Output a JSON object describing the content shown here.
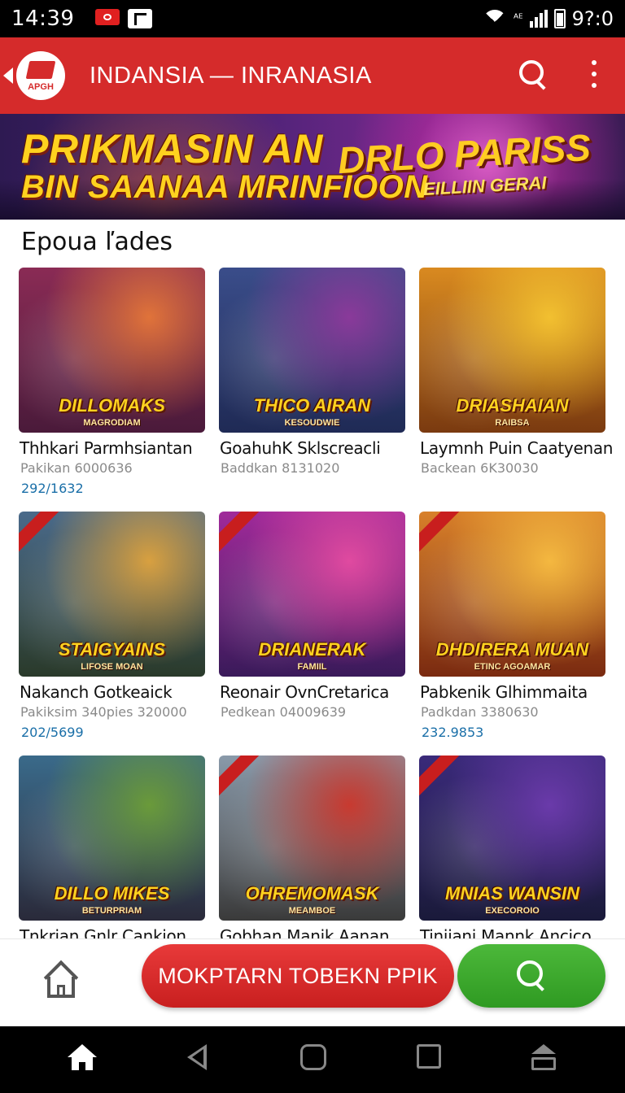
{
  "status_bar": {
    "time": "14:39",
    "network_label": "ᴬᴱ",
    "battery_text": "9?:0",
    "icons": [
      "notification-red-icon",
      "notification-square-icon",
      "wifi-icon",
      "signal-icon",
      "battery-icon"
    ]
  },
  "app_bar": {
    "logo_text": "APGH",
    "title": "INDANSIA  —  INRANASIA",
    "icons": [
      "back-arrow-icon",
      "search-icon",
      "more-vert-icon"
    ]
  },
  "banner": {
    "line1": "PRIKMASIN AN",
    "line2": "BIN SAANAA MRINFIOON",
    "logo_title": "DRLO PARISS",
    "logo_subtitle": "EILLIIN GERAI"
  },
  "section": {
    "title": "Epoua ľades"
  },
  "games": [
    {
      "thumb_title": "DILLOMAKS",
      "thumb_sub": "MAGRODIAM",
      "name": "Thhkari Parmhsiantan",
      "meta": "Pakikan 6000636",
      "count": "292/1632",
      "colors": [
        "#8a2b55",
        "#e0733a",
        "#4a1a3a"
      ]
    },
    {
      "thumb_title": "THICO AIRAN",
      "thumb_sub": "KESOUDWIE",
      "name": "GoahuhK Sklscreacli",
      "meta": "Baddkan 8131020",
      "count": "",
      "colors": [
        "#3a4d8a",
        "#8a3a9a",
        "#1f2a55"
      ]
    },
    {
      "thumb_title": "DRIASHAIAN",
      "thumb_sub": "RAIBSA",
      "name": "Laymnh Puin Caatyenan",
      "meta": "Backean 6K30030",
      "count": "",
      "colors": [
        "#d98a20",
        "#f2c030",
        "#7a3a10"
      ]
    },
    {
      "thumb_title": "STAIGYAINS",
      "thumb_sub": "LIFOSE MOAN",
      "name": "Nakanch Gotkeaick",
      "meta": "Pakiksim 340pies 320000",
      "count": "202/5699",
      "colors": [
        "#4a6a8a",
        "#d8a040",
        "#2a3a2a"
      ]
    },
    {
      "thumb_title": "DRIANERAK",
      "thumb_sub": "FAMIIL",
      "name": "Reonair OvnCretarica",
      "meta": "Pedkean 04009639",
      "count": "",
      "colors": [
        "#a02a9a",
        "#e04aa0",
        "#3a1a5a"
      ]
    },
    {
      "thumb_title": "DHDIRERA MUAN",
      "thumb_sub": "ETINC AGOAMAR",
      "name": "Pabkenik Glhimmaita",
      "meta": "Padkdan 3380630",
      "count": "232.9853",
      "colors": [
        "#d8802a",
        "#f4b840",
        "#7a2a10"
      ]
    },
    {
      "thumb_title": "DILLO MIKES",
      "thumb_sub": "BETURPRIAM",
      "name": "Tnkrian Gnlr Cankion",
      "meta": "",
      "count": "",
      "colors": [
        "#3a6a8a",
        "#6a9a3a",
        "#2a2a3a"
      ]
    },
    {
      "thumb_title": "OHREMOMASK",
      "thumb_sub": "MEAMBOE",
      "name": "Gobhan Manik Aanan",
      "meta": "",
      "count": "",
      "colors": [
        "#8a9aaa",
        "#c83a30",
        "#3a3a3a"
      ]
    },
    {
      "thumb_title": "MNIAS WANSIN",
      "thumb_sub": "EXECOROIO",
      "name": "Tiniiani Mannk Ancico",
      "meta": "",
      "count": "",
      "colors": [
        "#3a2a7a",
        "#6a3aaa",
        "#1a1a3a"
      ]
    }
  ],
  "action_bar": {
    "cta_label": "MOKPTARN TOBEKN PPIK",
    "icons": [
      "home-icon",
      "search-icon"
    ]
  },
  "nav_bar": {
    "icons": [
      "nav-home-icon",
      "nav-back-icon",
      "nav-home-circle-icon",
      "nav-recents-icon",
      "nav-keyboard-icon"
    ]
  },
  "colors": {
    "app_bar_red": "#d52b2b",
    "cta_red": "#d82c2c",
    "search_green": "#3aa82e",
    "count_blue": "#1a6fa8",
    "banner_yellow": "#ffd21f"
  }
}
